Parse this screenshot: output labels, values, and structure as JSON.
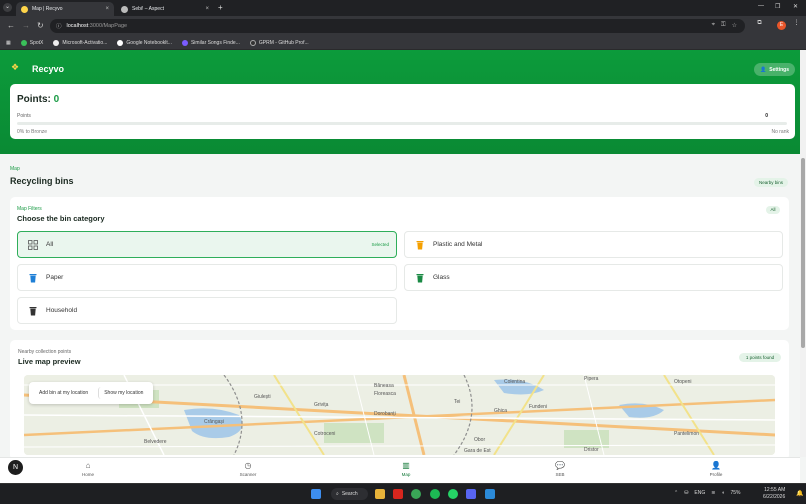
{
  "browser": {
    "tabs": [
      {
        "title": "Map | Recyvo",
        "active": true
      },
      {
        "title": "Sebi! – Aspect",
        "active": false
      }
    ],
    "url_host": "localhost",
    "url_path": ":3000/MapPage",
    "bookmarks": [
      "SpotX",
      "Microsoft-Activatio...",
      "Google Notebooklt...",
      "Similar Songs Finde...",
      "GPRM - GitHub Prof..."
    ],
    "profile_initial": "E"
  },
  "header": {
    "brand": "Recyvo",
    "settings_label": "Settings"
  },
  "points": {
    "title": "Points:",
    "value": "0",
    "label": "Points",
    "count": "0",
    "progress_left": "0% to Bronze",
    "progress_right": "No rank",
    "progress_fraction": 0
  },
  "map_page": {
    "breadcrumb": "Map",
    "title": "Recycling bins",
    "nearby_label": "Nearby bins"
  },
  "filters": {
    "eyebrow": "Map Filters",
    "title": "Choose the bin category",
    "all_chip": "All",
    "selected_label": "Selected",
    "bins": [
      {
        "label": "All",
        "icon": "grid-icon",
        "color": "#555555",
        "selected": true
      },
      {
        "label": "Plastic and Metal",
        "icon": "bin-icon",
        "color": "#f5a000",
        "selected": false
      },
      {
        "label": "Paper",
        "icon": "bin-icon",
        "color": "#1e7fd6",
        "selected": false
      },
      {
        "label": "Glass",
        "icon": "bin-icon",
        "color": "#1a8a44",
        "selected": false
      },
      {
        "label": "Household",
        "icon": "bin-icon",
        "color": "#333333",
        "selected": false
      }
    ]
  },
  "map_preview": {
    "eyebrow": "Nearby collection points",
    "title": "Live map preview",
    "found_label": "1 points found",
    "add_bin_label": "Add bin at my location",
    "show_location_label": "Show my location",
    "place_labels": [
      "Otopeni",
      "Băneasa",
      "Colentina",
      "Pipera",
      "Tei",
      "Floreasca",
      "Dorobanți",
      "Fundeni",
      "Giulești",
      "Grivița",
      "Ghica",
      "Pantelimon",
      "Crângași",
      "Cotroceni",
      "Obor",
      "Belvedere",
      "Gara de Est",
      "Dristor"
    ]
  },
  "bottom_nav": {
    "items": [
      {
        "label": "Home",
        "icon": "home-icon",
        "active": false
      },
      {
        "label": "Scanner",
        "icon": "scanner-icon",
        "active": false
      },
      {
        "label": "Map",
        "icon": "map-icon",
        "active": true
      },
      {
        "label": "SEB",
        "icon": "chat-icon",
        "active": false
      },
      {
        "label": "Profile",
        "icon": "profile-icon",
        "active": false
      }
    ],
    "fab_label": "N"
  },
  "taskbar": {
    "search_label": "Search",
    "language": "ENG",
    "battery": "75%",
    "time": "12:55 AM",
    "date": "6/22/2026"
  },
  "colors": {
    "brand_green": "#0c9b3b",
    "accent_green": "#1a9b45"
  }
}
